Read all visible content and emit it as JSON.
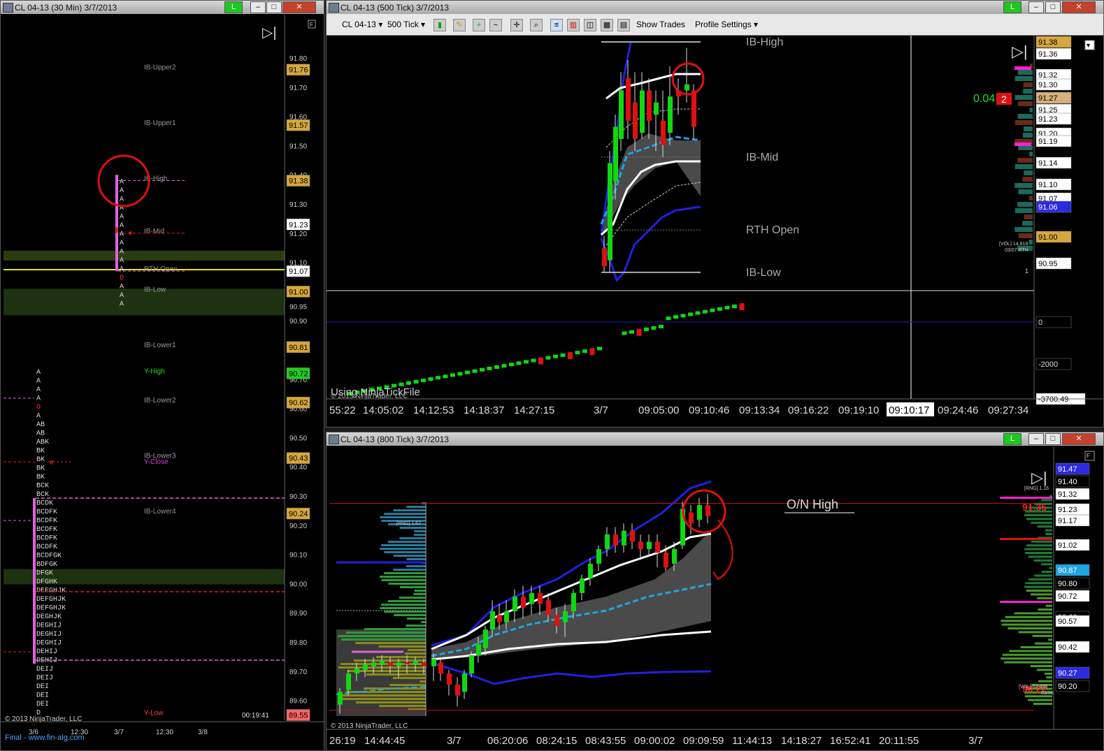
{
  "left_window": {
    "title": "CL 04-13 (30 Min)  3/7/2013",
    "connection": "L",
    "price_labels": [
      "91.80",
      "91.70",
      "91.60",
      "91.50",
      "91.40",
      "91.30",
      "91.20",
      "91.10",
      "90.95",
      "90.90",
      "90.80",
      "90.70",
      "90.60",
      "90.50",
      "90.40",
      "90.30",
      "90.20",
      "90.10",
      "90.00",
      "89.90",
      "89.80",
      "89.70",
      "89.60"
    ],
    "markers": [
      {
        "text": "91.76",
        "color": "#d6a73c"
      },
      {
        "text": "91.57",
        "color": "#d6a73c"
      },
      {
        "text": "91.38",
        "color": "#d6a73c"
      },
      {
        "text": "91.23",
        "color": "#ffffff"
      },
      {
        "text": "91.07",
        "color": "#ffffff"
      },
      {
        "text": "91.00",
        "color": "#d6a73c"
      },
      {
        "text": "90.81",
        "color": "#d6a73c"
      },
      {
        "text": "90.72",
        "color": "#22cc22"
      },
      {
        "text": "90.62",
        "color": "#d6a73c"
      },
      {
        "text": "90.43",
        "color": "#d6a73c"
      },
      {
        "text": "90.24",
        "color": "#d6a73c"
      },
      {
        "text": "89.55",
        "color": "#ff6666"
      }
    ],
    "levels": [
      "IB-Upper2",
      "IB-Upper1",
      "IB-High",
      "IB-Mid",
      "RTH Open",
      "IB-Low",
      "IB-Lower1",
      "Y-High",
      "IB-Lower2",
      "IB-Lower3",
      "Y-Close",
      "IB-Lower4",
      "Y-Low"
    ],
    "tpo_today": [
      "A",
      "A",
      "A",
      "A",
      "A",
      "A",
      "A",
      "A",
      "A",
      "A",
      "A",
      "D",
      "A",
      "A",
      "A"
    ],
    "tpo_prev": [
      "A",
      "A",
      "A",
      "A",
      "O",
      "A",
      "AB",
      "AB",
      "ABK",
      "BK",
      "BK",
      "BK",
      "BK",
      "BCK",
      "BCK",
      "BCDK",
      "BCDFK",
      "BCDFK",
      "BCDFK",
      "BCDFK",
      "BCDFK",
      "BCDFGK",
      "BDFGK",
      "DFGK",
      "DFGHK",
      "DEFGHJK",
      "DEFGHJK",
      "DEFGHJK",
      "DEGHJK",
      "DEGHIJ",
      "DEGHIJ",
      "DEGHIJ",
      "DEHIJ",
      "DEHIJ",
      "DEIJ",
      "DEIJ",
      "DEI",
      "DEI",
      "DEI",
      "D"
    ],
    "time_axis": [
      "3/6",
      "12:30",
      "3/7",
      "12:30",
      "3/8"
    ],
    "copyright": "© 2013 NinjaTrader, LLC",
    "clock": "00:19:41",
    "footnote": "Final - www.fin-alg.com"
  },
  "top_window": {
    "title": "CL 04-13 (500 Tick)  3/7/2013",
    "connection": "L",
    "toolbar": {
      "instrument": "CL 04-13",
      "interval": "500 Tick",
      "show_trades": "Show Trades",
      "profile_settings": "Profile Settings"
    },
    "level_labels": [
      "IB-High",
      "IB-Mid",
      "RTH Open",
      "IB-Low"
    ],
    "price_labels": [
      "91.38",
      "91.36",
      "91.32",
      "91.30",
      "91.27",
      "91.25",
      "91.23",
      "91.20",
      "91.19",
      "91.14",
      "91.10",
      "91.07",
      "91.06",
      "91.00",
      "90.95"
    ],
    "delta_value": "0.04",
    "position_qty": "2",
    "vol_note": "[VOL] 14,818",
    "vol_date": "03/07 RTH",
    "page_num": "1",
    "indicator_labels": [
      "0",
      "-2000",
      "-3700.49"
    ],
    "watermark": "Using NinjaTickFile",
    "copyright": "© 2013 NinjaTrader, LLC",
    "time_axis": [
      "55:22",
      "14:05:02",
      "14:12:53",
      "14:18:37",
      "14:27:15",
      "3/7",
      "09:05:00",
      "09:10:46",
      "09:13:34",
      "09:16:22",
      "09:19:10",
      "09:10:17",
      "09:24:46",
      "09:27:34"
    ],
    "crosshair_time": "09:10:17"
  },
  "bottom_window": {
    "title": "CL 04-13 (800 Tick)  3/7/2013",
    "connection": "L",
    "on_high_label": "O/N High",
    "rng_left": "[RNG] 1.62",
    "rng_right": "[RNG] 1.16",
    "red_labels": [
      "91.35",
      "90.22"
    ],
    "price_labels": [
      "91.47",
      "91.40",
      "91.32",
      "91.23",
      "91.17",
      "91.02",
      "90.87",
      "90.80",
      "90.72",
      "90.60",
      "90.57",
      "90.42",
      "90.27",
      "90.20"
    ],
    "vol_note": "[VOL] 62,433",
    "vol_date": "03/06",
    "copyright": "© 2013 NinjaTrader, LLC",
    "time_axis": [
      "26:19",
      "14:44:45",
      "3/7",
      "06:20:06",
      "08:24:15",
      "08:43:55",
      "09:00:02",
      "09:09:59",
      "11:44:13",
      "14:18:27",
      "16:52:41",
      "20:11:55",
      "3/7"
    ]
  },
  "colors": {
    "up": "#10d810",
    "down": "#e01010",
    "band": "#2020e0",
    "mid": "#1ea5e6",
    "ibline": "#e060e0"
  }
}
